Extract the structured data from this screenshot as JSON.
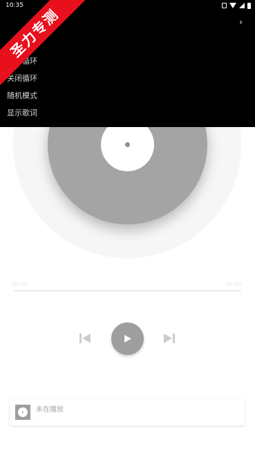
{
  "status_bar": {
    "time": "10:35",
    "icons": [
      "vibrate-icon",
      "wifi-icon",
      "signal-icon",
      "battery-icon"
    ]
  },
  "menu": {
    "items": [
      "",
      "顺序循环",
      "关闭循环",
      "随机模式",
      "显示歌词"
    ],
    "chevron": "›"
  },
  "ribbon": {
    "text": "圣力专测",
    "color": "#e8101d"
  },
  "player": {
    "time_current": "00:00",
    "time_total": "00:00",
    "progress": 0
  },
  "now_playing": {
    "title": "未在播放",
    "subtitle": "-"
  },
  "colors": {
    "disc": "#a4a4a4",
    "play_button": "#9e9e9e",
    "controls": "#cccccc"
  }
}
